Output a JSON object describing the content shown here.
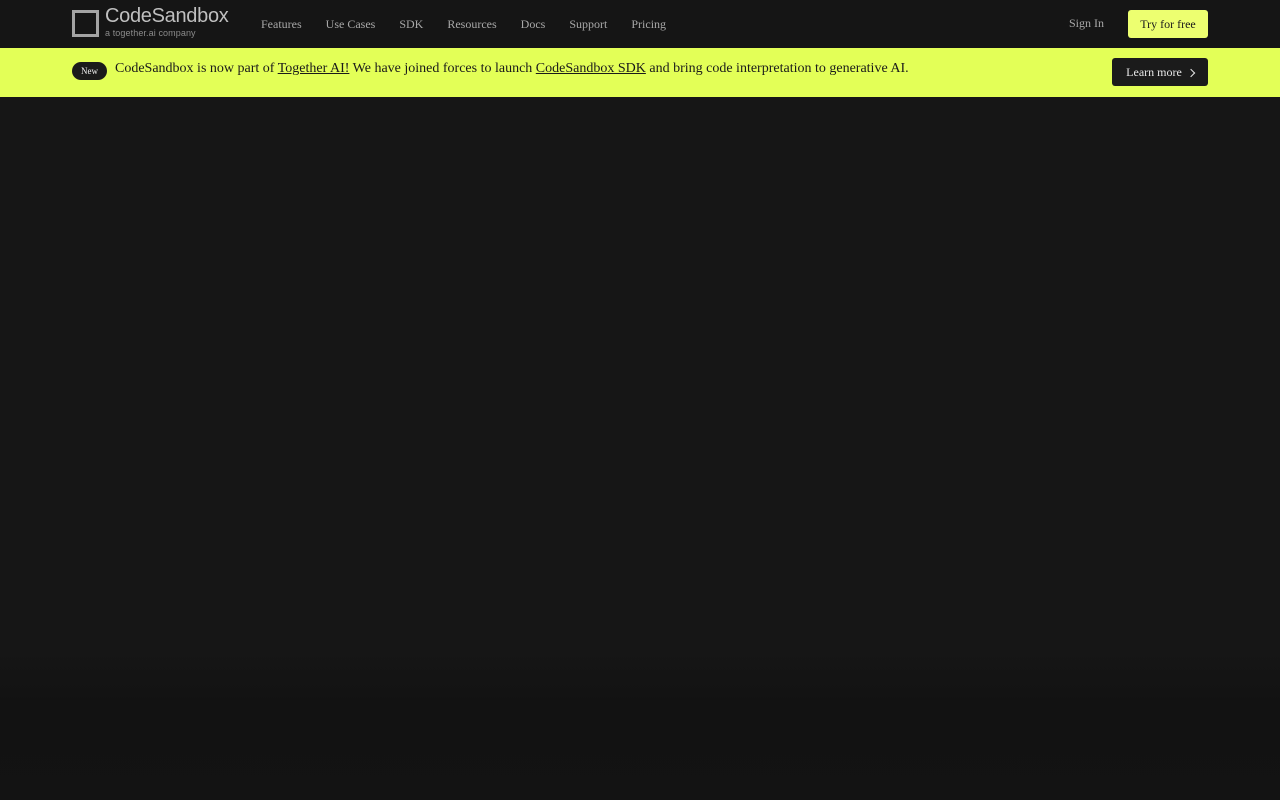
{
  "brand": {
    "name": "CodeSandbox",
    "tagline": "a together.ai company"
  },
  "nav": {
    "links": [
      "Features",
      "Use Cases",
      "SDK",
      "Resources",
      "Docs",
      "Support",
      "Pricing"
    ],
    "sign_in": "Sign In",
    "try_free": "Try for free"
  },
  "banner": {
    "badge": "New",
    "text_1": "CodeSandbox is now part of ",
    "link_1": "Together AI!",
    "text_2": " We have joined forces to launch ",
    "link_2": "CodeSandbox SDK",
    "text_3": " and bring code interpretation to generative AI.",
    "learn_more": "Learn more",
    "colors": {
      "background": "#e3ff57",
      "accent_button": "#edff70"
    }
  },
  "icons": {
    "logo": "square-outline-logo",
    "learn_more_arrow": "chevron-right-icon"
  }
}
